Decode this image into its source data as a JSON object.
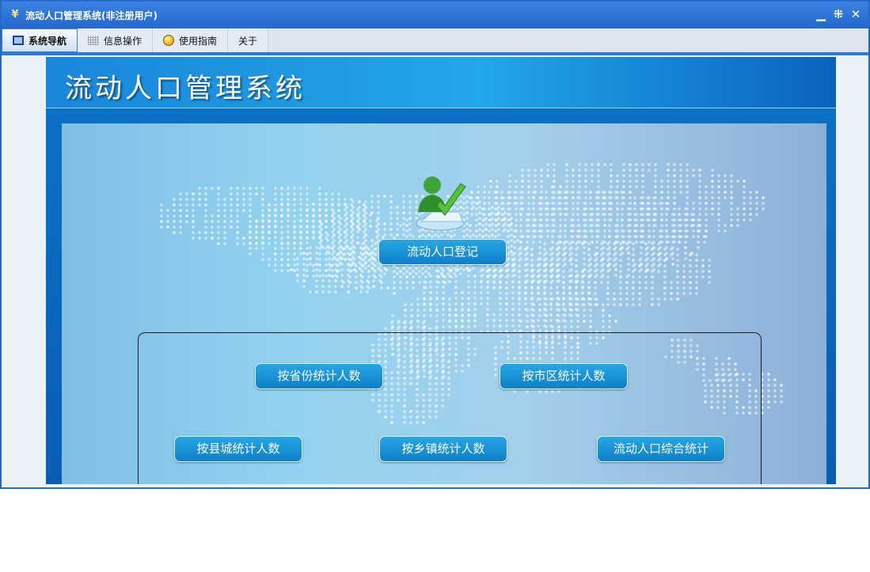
{
  "window": {
    "title": "流动人口管理系统(非注册用户)",
    "controls": {
      "minimize": "▁",
      "restore": "⁜",
      "close": "✕"
    }
  },
  "menu": {
    "tabs": [
      {
        "label": "系统导航",
        "icon": "monitor-icon",
        "active": true
      },
      {
        "label": "信息操作",
        "icon": "grid-icon",
        "active": false
      },
      {
        "label": "使用指南",
        "icon": "help-icon",
        "active": false
      },
      {
        "label": "关于",
        "icon": "",
        "active": false
      }
    ]
  },
  "banner": {
    "title": "流动人口管理系统"
  },
  "main": {
    "register_label": "流动人口登记",
    "stats": {
      "by_province": "按省份统计人数",
      "by_city": "按市区统计人数",
      "by_county": "按县城统计人数",
      "by_town": "按乡镇统计人数",
      "summary": "流动人口综合统计"
    }
  },
  "colors": {
    "title_bar": "#2368cf",
    "accent": "#2f77d6",
    "button": "#0d7fc9",
    "banner": "#22a6ec"
  }
}
